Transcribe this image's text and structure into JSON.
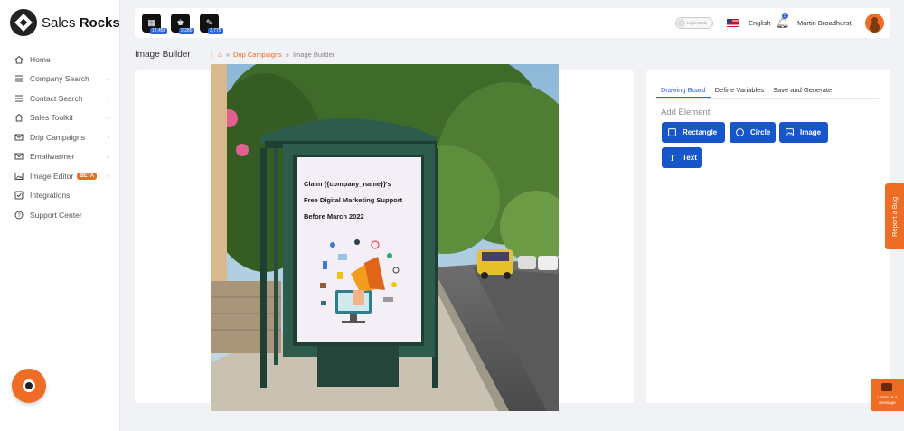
{
  "brand": {
    "name_light": "Sales",
    "name_bold": "Rocks"
  },
  "sidebar": {
    "items": [
      {
        "label": "Home",
        "icon": "home-icon",
        "chevron": false
      },
      {
        "label": "Company Search",
        "icon": "list-icon",
        "chevron": true
      },
      {
        "label": "Contact Search",
        "icon": "list-icon",
        "chevron": true
      },
      {
        "label": "Sales Toolkit",
        "icon": "home-icon",
        "chevron": true
      },
      {
        "label": "Drip Campaigns",
        "icon": "mail-icon",
        "chevron": true
      },
      {
        "label": "Emailwarmer",
        "icon": "mail-icon",
        "chevron": true
      },
      {
        "label": "Image Editor",
        "icon": "image-icon",
        "chevron": true,
        "badge": "BETA"
      },
      {
        "label": "Integrations",
        "icon": "checkbox-icon",
        "chevron": false
      },
      {
        "label": "Support Center",
        "icon": "help-icon",
        "chevron": false
      }
    ]
  },
  "topbar": {
    "counters": [
      {
        "icon": "company-icon",
        "value": "12,456"
      },
      {
        "icon": "contacts-icon",
        "value": "2,285"
      },
      {
        "icon": "tools-icon",
        "value": "3,775"
      }
    ],
    "theme_toggle": "Light Mode",
    "language": "English",
    "notifications": "5",
    "user_name": "Martin Broadhurst"
  },
  "breadcrumb": {
    "page_title": "Image Builder",
    "separator": "»",
    "link": "Drip Campaigns",
    "current": "Image Builder"
  },
  "poster": {
    "line1": "Claim {{company_name}}'s",
    "line2": "Free Digital Marketing Support",
    "line3": "Before March 2022"
  },
  "panel": {
    "tabs": [
      "Drawing Board",
      "Define Variables",
      "Save and Generate"
    ],
    "add_element_label": "Add Element",
    "tools": {
      "rectangle": "Rectangle",
      "circle": "Circle",
      "image": "Image",
      "text": "Text"
    }
  },
  "widgets": {
    "report_bug": "Report a Bug",
    "chat": "Leave us a message"
  },
  "colors": {
    "accent": "#ef6c24",
    "primary": "#1756c8"
  }
}
